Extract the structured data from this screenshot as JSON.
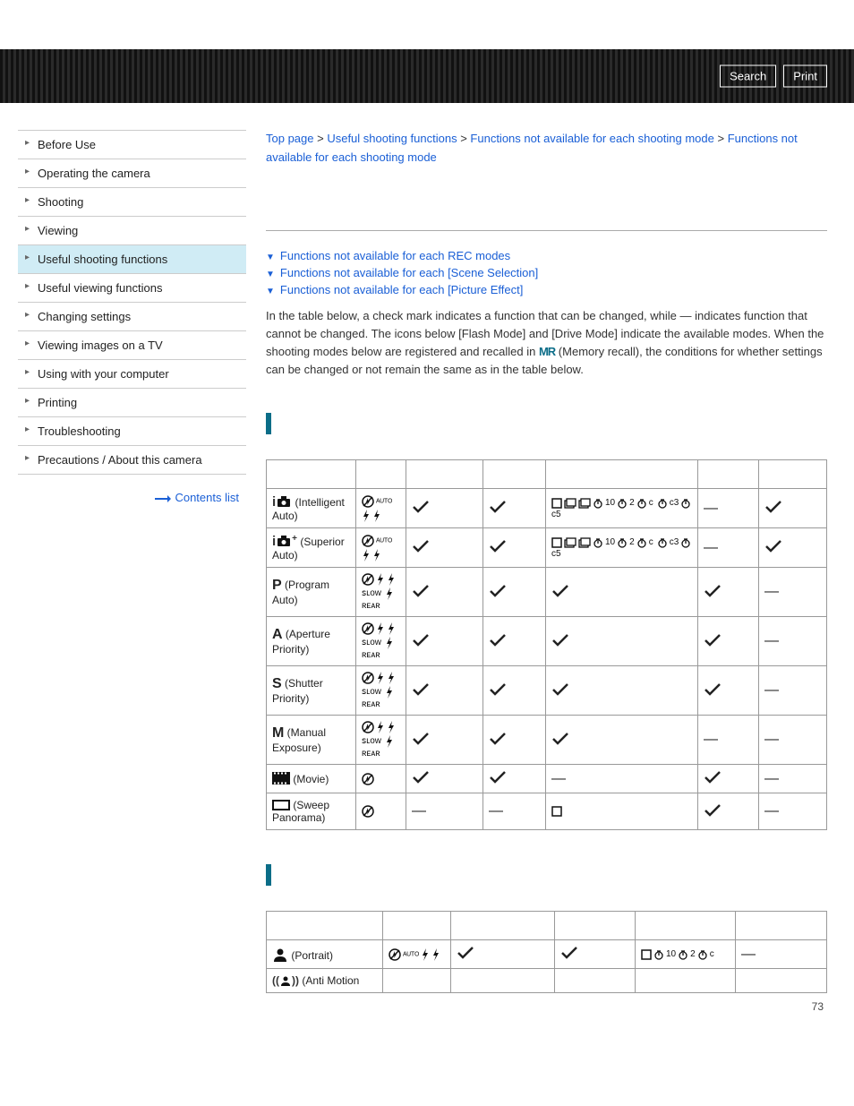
{
  "header": {
    "search": "Search",
    "print": "Print"
  },
  "sidebar": {
    "items": [
      "Before Use",
      "Operating the camera",
      "Shooting",
      "Viewing",
      "Useful shooting functions",
      "Useful viewing functions",
      "Changing settings",
      "Viewing images on a TV",
      "Using with your computer",
      "Printing",
      "Troubleshooting",
      "Precautions / About this camera"
    ],
    "active_index": 4,
    "contents_list": "Contents list"
  },
  "breadcrumb": {
    "top": "Top page",
    "sep": " > ",
    "l1": "Useful shooting functions",
    "l2": "Functions not available for each shooting mode",
    "current": "Functions not available for each shooting mode"
  },
  "anchors": [
    "Functions not available for each REC modes",
    "Functions not available for each [Scene Selection]",
    "Functions not available for each [Picture Effect]"
  ],
  "intro": {
    "p1a": "In the table below, a check mark indicates a function that can be changed, while — indicates function that cannot be changed. The icons below [Flash Mode] and [Drive Mode] indicate the available modes. When the shooting modes below are registered and recalled in ",
    "mr": "MR",
    "p1b": " (Memory recall), the conditions for whether settings can be changed or not remain the same as in the table below."
  },
  "table1": {
    "headers": [
      "",
      "",
      "",
      "",
      "",
      "",
      ""
    ],
    "rows": [
      {
        "mode_glyph": "iA",
        "mode_suffix": " (Intelligent Auto)",
        "flash_icons": "auto-set-a",
        "expcomp": "check",
        "wb": "check",
        "drive_icons": "full-set",
        "creative": "dash",
        "pic_effect": "check"
      },
      {
        "mode_glyph": "iA+",
        "mode_suffix": " (Superior Auto)",
        "flash_icons": "auto-set-a",
        "expcomp": "check",
        "wb": "check",
        "drive_icons": "full-set",
        "creative": "dash",
        "pic_effect": "check"
      },
      {
        "mode_glyph": "P",
        "mode_suffix": " (Program Auto)",
        "flash_icons": "full-flash",
        "expcomp": "check",
        "wb": "check",
        "drive_icons": "check",
        "creative": "check",
        "pic_effect": "dash"
      },
      {
        "mode_glyph": "A",
        "mode_suffix": " (Aperture Priority)",
        "flash_icons": "full-flash",
        "expcomp": "check",
        "wb": "check",
        "drive_icons": "check",
        "creative": "check",
        "pic_effect": "dash"
      },
      {
        "mode_glyph": "S",
        "mode_suffix": " (Shutter Priority)",
        "flash_icons": "full-flash",
        "expcomp": "check",
        "wb": "check",
        "drive_icons": "check",
        "creative": "check",
        "pic_effect": "dash"
      },
      {
        "mode_glyph": "M",
        "mode_suffix": " (Manual Exposure)",
        "flash_icons": "full-flash",
        "expcomp": "check",
        "wb": "check",
        "drive_icons": "check",
        "creative": "dash",
        "pic_effect": "dash"
      },
      {
        "mode_glyph": "MOVIE",
        "mode_suffix": " (Movie)",
        "flash_icons": "off-only",
        "expcomp": "check",
        "wb": "check",
        "drive_icons": "dash",
        "creative": "check",
        "pic_effect": "dash"
      },
      {
        "mode_glyph": "PANO",
        "mode_suffix": " (Sweep Panorama)",
        "flash_icons": "off-only",
        "expcomp": "dash",
        "wb": "dash",
        "drive_icons": "single-only",
        "creative": "check",
        "pic_effect": "dash"
      }
    ]
  },
  "table2": {
    "headers": [
      "",
      "",
      "",
      "",
      "",
      ""
    ],
    "rows": [
      {
        "mode_glyph": "PORTRAIT",
        "mode_suffix": " (Portrait)",
        "flash_icons": "auto-set-a",
        "expcomp": "check",
        "wb": "check",
        "drive_icons": "timer-set",
        "creative": "dash"
      },
      {
        "mode_glyph": "ANTIMOTION",
        "mode_suffix": " (Anti Motion",
        "flash_icons": "",
        "expcomp": "",
        "wb": "",
        "drive_icons": "",
        "creative": ""
      }
    ]
  },
  "icons": {
    "auto_set_a": "⊘ ᴬᵁᵀᴼ ⚡",
    "full_flash": "⊘ ⚡ ⚡ꜱʟᴏᴡ ⚡ʀᴇᴀʀ",
    "off_only": "⊘",
    "drive_full": "▢ ▢ᴴ ▢ᴸ 𝄐₁₀ 𝄐₂ 𝄐ᴄ 𝄐ᴄ₃ 𝄐ᴄ₅",
    "drive_single": "▢",
    "drive_timer": "▢ 𝄐₁₀ 𝄐₂ 𝄐ᴄ"
  },
  "page_number": "73"
}
